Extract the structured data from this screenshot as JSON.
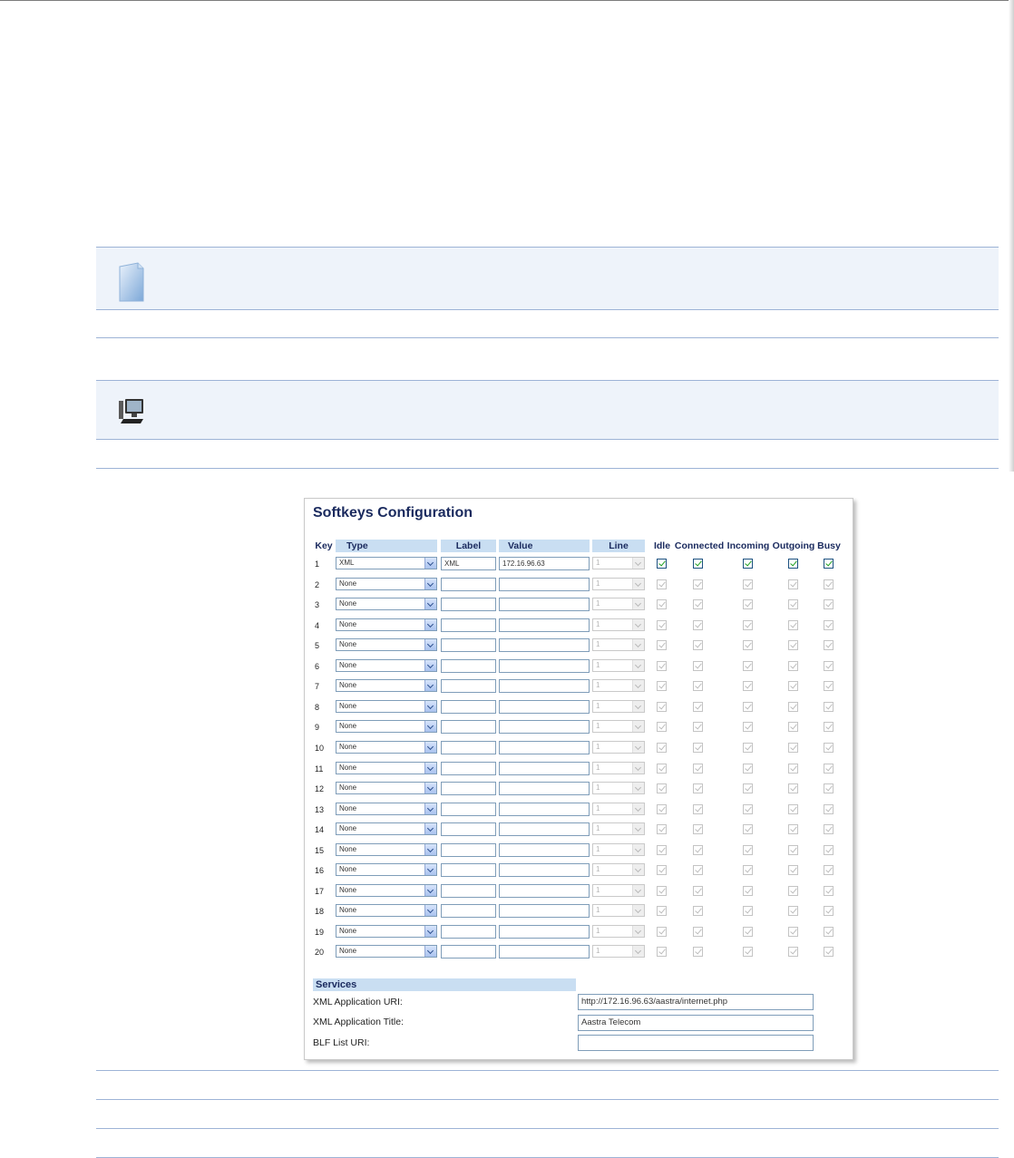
{
  "panel": {
    "title": "Softkeys Configuration",
    "headers": {
      "key": "Key",
      "type": "Type",
      "label": "Label",
      "value": "Value",
      "line": "Line",
      "idle": "Idle",
      "connected": "Connected",
      "incoming": "Incoming",
      "outgoing": "Outgoing",
      "busy": "Busy"
    },
    "rows": [
      {
        "key": "1",
        "type": "XML",
        "label": "XML",
        "value": "172.16.96.63",
        "line": "1"
      },
      {
        "key": "2",
        "type": "None",
        "label": "",
        "value": "",
        "line": "1"
      },
      {
        "key": "3",
        "type": "None",
        "label": "",
        "value": "",
        "line": "1"
      },
      {
        "key": "4",
        "type": "None",
        "label": "",
        "value": "",
        "line": "1"
      },
      {
        "key": "5",
        "type": "None",
        "label": "",
        "value": "",
        "line": "1"
      },
      {
        "key": "6",
        "type": "None",
        "label": "",
        "value": "",
        "line": "1"
      },
      {
        "key": "7",
        "type": "None",
        "label": "",
        "value": "",
        "line": "1"
      },
      {
        "key": "8",
        "type": "None",
        "label": "",
        "value": "",
        "line": "1"
      },
      {
        "key": "9",
        "type": "None",
        "label": "",
        "value": "",
        "line": "1"
      },
      {
        "key": "10",
        "type": "None",
        "label": "",
        "value": "",
        "line": "1"
      },
      {
        "key": "11",
        "type": "None",
        "label": "",
        "value": "",
        "line": "1"
      },
      {
        "key": "12",
        "type": "None",
        "label": "",
        "value": "",
        "line": "1"
      },
      {
        "key": "13",
        "type": "None",
        "label": "",
        "value": "",
        "line": "1"
      },
      {
        "key": "14",
        "type": "None",
        "label": "",
        "value": "",
        "line": "1"
      },
      {
        "key": "15",
        "type": "None",
        "label": "",
        "value": "",
        "line": "1"
      },
      {
        "key": "16",
        "type": "None",
        "label": "",
        "value": "",
        "line": "1"
      },
      {
        "key": "17",
        "type": "None",
        "label": "",
        "value": "",
        "line": "1"
      },
      {
        "key": "18",
        "type": "None",
        "label": "",
        "value": "",
        "line": "1"
      },
      {
        "key": "19",
        "type": "None",
        "label": "",
        "value": "",
        "line": "1"
      },
      {
        "key": "20",
        "type": "None",
        "label": "",
        "value": "",
        "line": "1"
      }
    ],
    "services": {
      "heading": "Services",
      "xml_uri_label": "XML Application URI:",
      "xml_uri_value": "http://172.16.96.63/aastra/internet.php",
      "xml_title_label": "XML Application Title:",
      "xml_title_value": "Aastra Telecom",
      "blf_label": "BLF List URI:",
      "blf_value": ""
    }
  },
  "colors": {
    "accent": "#1a2a5e",
    "header_fill": "#c9def2",
    "rule": "#9db3d6",
    "band": "#eef3fa",
    "check": "#21a121"
  },
  "icons": {
    "note": "note-icon",
    "computer": "computer-icon"
  }
}
